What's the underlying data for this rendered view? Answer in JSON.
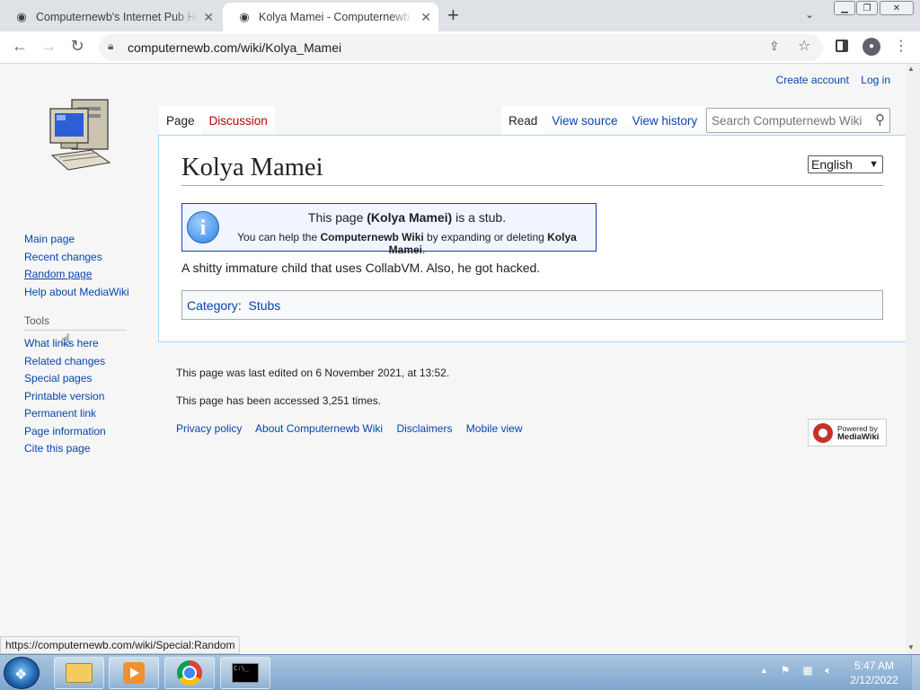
{
  "browser": {
    "tabs": [
      {
        "title": "Computernewb's Internet Pub Hub",
        "active": false
      },
      {
        "title": "Kolya Mamei - Computernewb Wiki",
        "active": true
      }
    ],
    "new_tab": "+",
    "close": "✕",
    "url": "computernewb.com/wiki/Kolya_Mamei",
    "status_url": "https://computernewb.com/wiki/Special:Random"
  },
  "personal": {
    "create_account": "Create account",
    "log_in": "Log in"
  },
  "sidebar": {
    "navigation": [
      "Main page",
      "Recent changes",
      "Random page",
      "Help about MediaWiki"
    ],
    "tools_heading": "Tools",
    "tools": [
      "What links here",
      "Related changes",
      "Special pages",
      "Printable version",
      "Permanent link",
      "Page information",
      "Cite this page"
    ]
  },
  "tabs": {
    "page": "Page",
    "discussion": "Discussion",
    "read": "Read",
    "view_source": "View source",
    "view_history": "View history"
  },
  "search": {
    "placeholder": "Search Computernewb Wiki"
  },
  "article": {
    "title": "Kolya Mamei",
    "language": "English",
    "stub": {
      "l1_a": "This page ",
      "l1_b": "(Kolya Mamei)",
      "l1_c": " is a stub.",
      "l2_a": "You can help the ",
      "l2_b": "Computernewb Wiki",
      "l2_c": " by expanding or deleting ",
      "l2_d": "Kolya Mamei",
      "l2_e": "."
    },
    "body": "A shitty immature child that uses CollabVM. Also, he got hacked.",
    "category_label": "Category",
    "category": "Stubs"
  },
  "footer": {
    "last_edited": "This page was last edited on 6 November 2021, at 13:52.",
    "accessed": "This page has been accessed 3,251 times.",
    "links": [
      "Privacy policy",
      "About Computernewb Wiki",
      "Disclaimers",
      "Mobile view"
    ],
    "powered_line1": "Powered by",
    "powered_line2": "MediaWiki"
  },
  "taskbar": {
    "time": "5:47 AM",
    "date": "2/12/2022"
  }
}
